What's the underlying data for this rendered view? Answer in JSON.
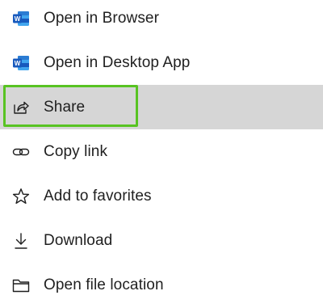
{
  "menu": {
    "items": [
      {
        "label": "Open in Browser",
        "icon": "word-icon"
      },
      {
        "label": "Open in Desktop App",
        "icon": "word-icon"
      },
      {
        "label": "Share",
        "icon": "share-icon",
        "highlighted": true
      },
      {
        "label": "Copy link",
        "icon": "link-icon"
      },
      {
        "label": "Add to favorites",
        "icon": "star-icon"
      },
      {
        "label": "Download",
        "icon": "download-icon"
      },
      {
        "label": "Open file location",
        "icon": "folder-icon"
      }
    ]
  },
  "colors": {
    "highlight_background": "#d6d6d6",
    "focus_ring": "#58c322",
    "word_blue": "#185abd",
    "text": "#1f1f1f"
  }
}
